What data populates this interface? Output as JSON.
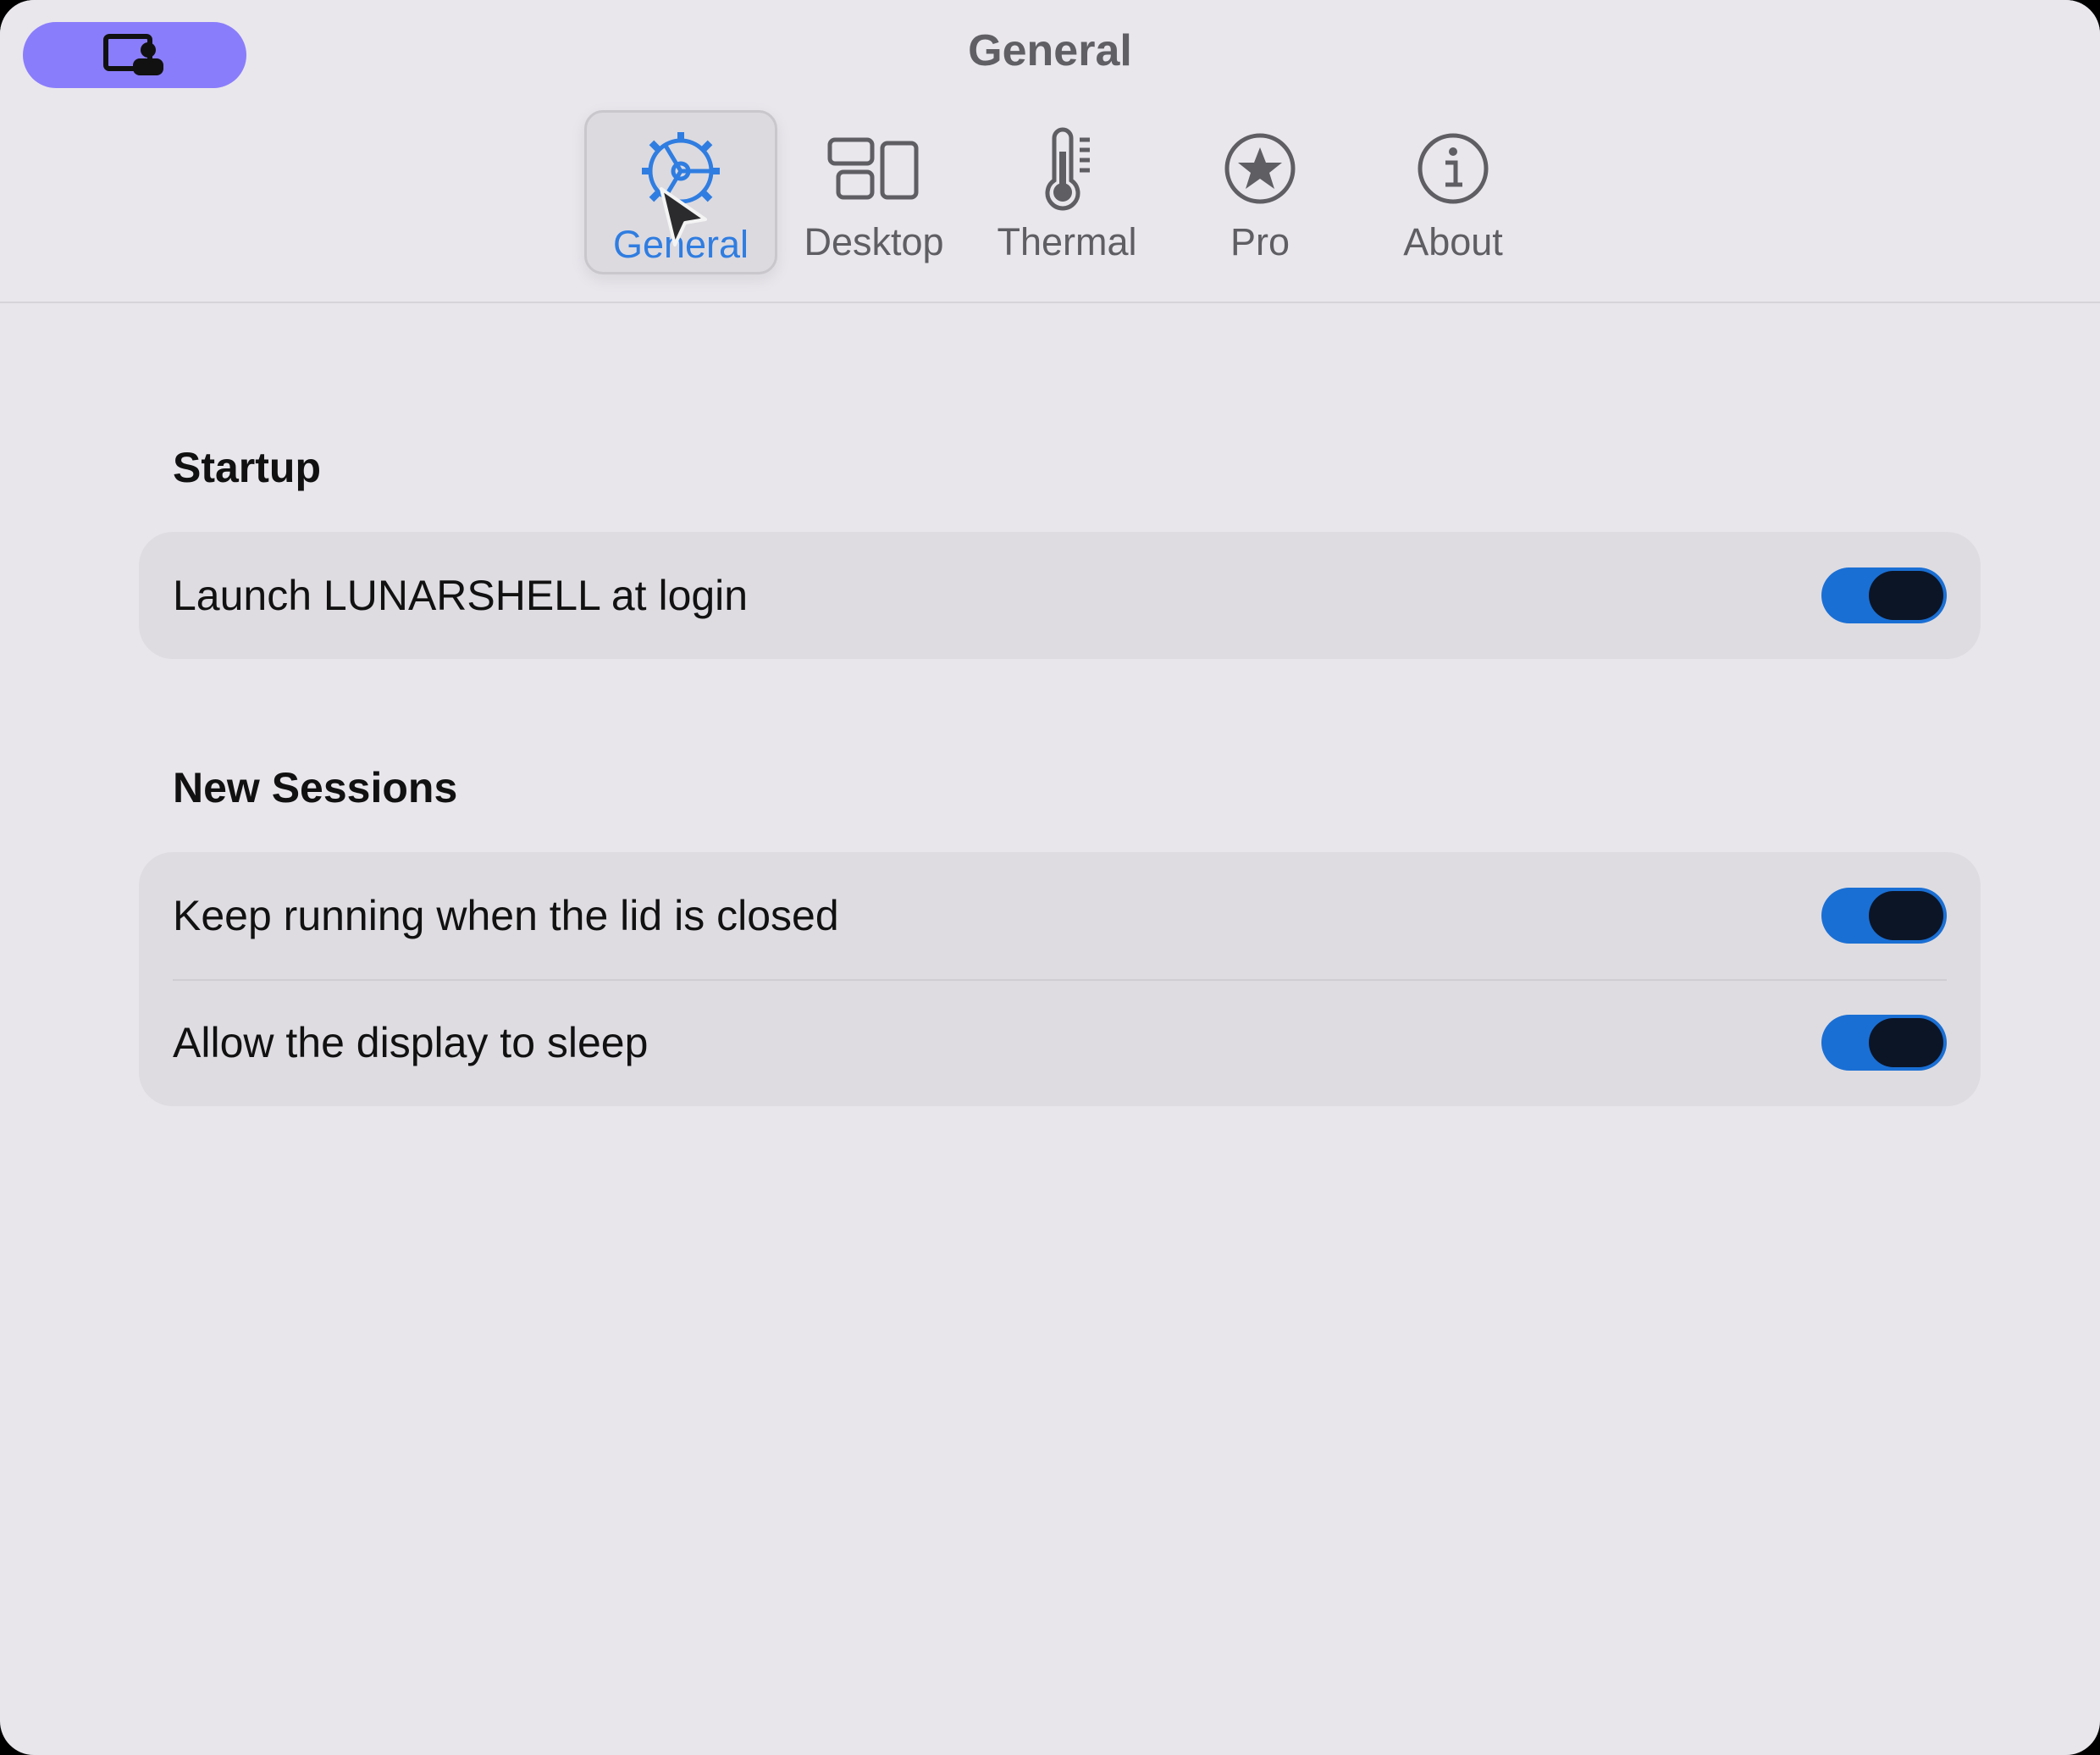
{
  "window": {
    "title": "General",
    "accent_color": "#2f7de1",
    "pill_color": "#8a7dfb"
  },
  "tabs": [
    {
      "id": "general",
      "label": "General",
      "icon": "gear-icon",
      "active": true
    },
    {
      "id": "desktop",
      "label": "Desktop",
      "icon": "desktop-layout-icon",
      "active": false
    },
    {
      "id": "thermal",
      "label": "Thermal",
      "icon": "thermometer-icon",
      "active": false
    },
    {
      "id": "pro",
      "label": "Pro",
      "icon": "star-circle-icon",
      "active": false
    },
    {
      "id": "about",
      "label": "About",
      "icon": "info-circle-icon",
      "active": false
    }
  ],
  "sections": {
    "startup": {
      "title": "Startup",
      "rows": [
        {
          "label": "Launch LUNARSHELL at login",
          "enabled": true
        }
      ]
    },
    "new_sessions": {
      "title": "New Sessions",
      "rows": [
        {
          "label": "Keep running when the lid is closed",
          "enabled": true
        },
        {
          "label": "Allow the display to sleep",
          "enabled": true
        }
      ]
    }
  }
}
